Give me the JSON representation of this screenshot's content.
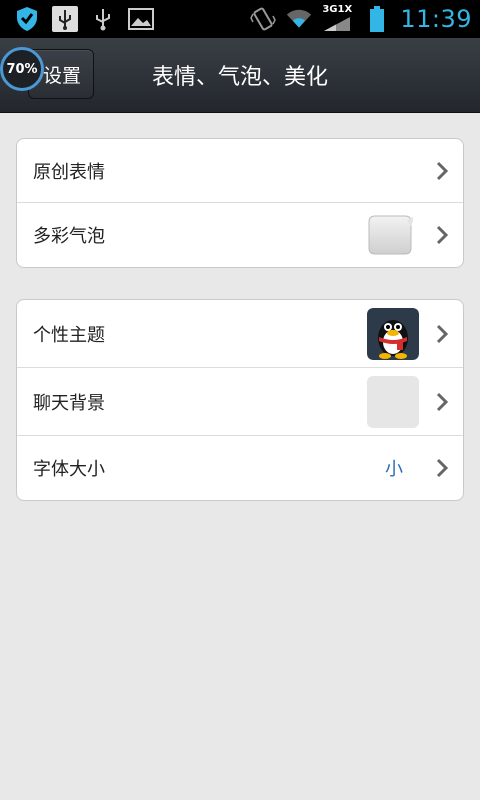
{
  "status_bar": {
    "time": "11:39",
    "network_label_top": "3G",
    "network_label_top2": "1X",
    "battery_color": "#33b5e5",
    "icons": [
      "shield-icon",
      "usb-icon",
      "usb-plain-icon",
      "image-icon",
      "vibrate-icon",
      "wifi-icon",
      "signal-icon",
      "battery-icon"
    ]
  },
  "header": {
    "badge": "70%",
    "back_label": "设置",
    "title": "表情、气泡、美化"
  },
  "group1": {
    "items": [
      {
        "label": "原创表情"
      },
      {
        "label": "多彩气泡"
      }
    ]
  },
  "group2": {
    "items": [
      {
        "label": "个性主题"
      },
      {
        "label": "聊天背景"
      },
      {
        "label": "字体大小",
        "value": "小"
      }
    ]
  },
  "colors": {
    "accent": "#33b5e5",
    "value_text": "#2a6db5",
    "background": "#e8e8e8"
  }
}
